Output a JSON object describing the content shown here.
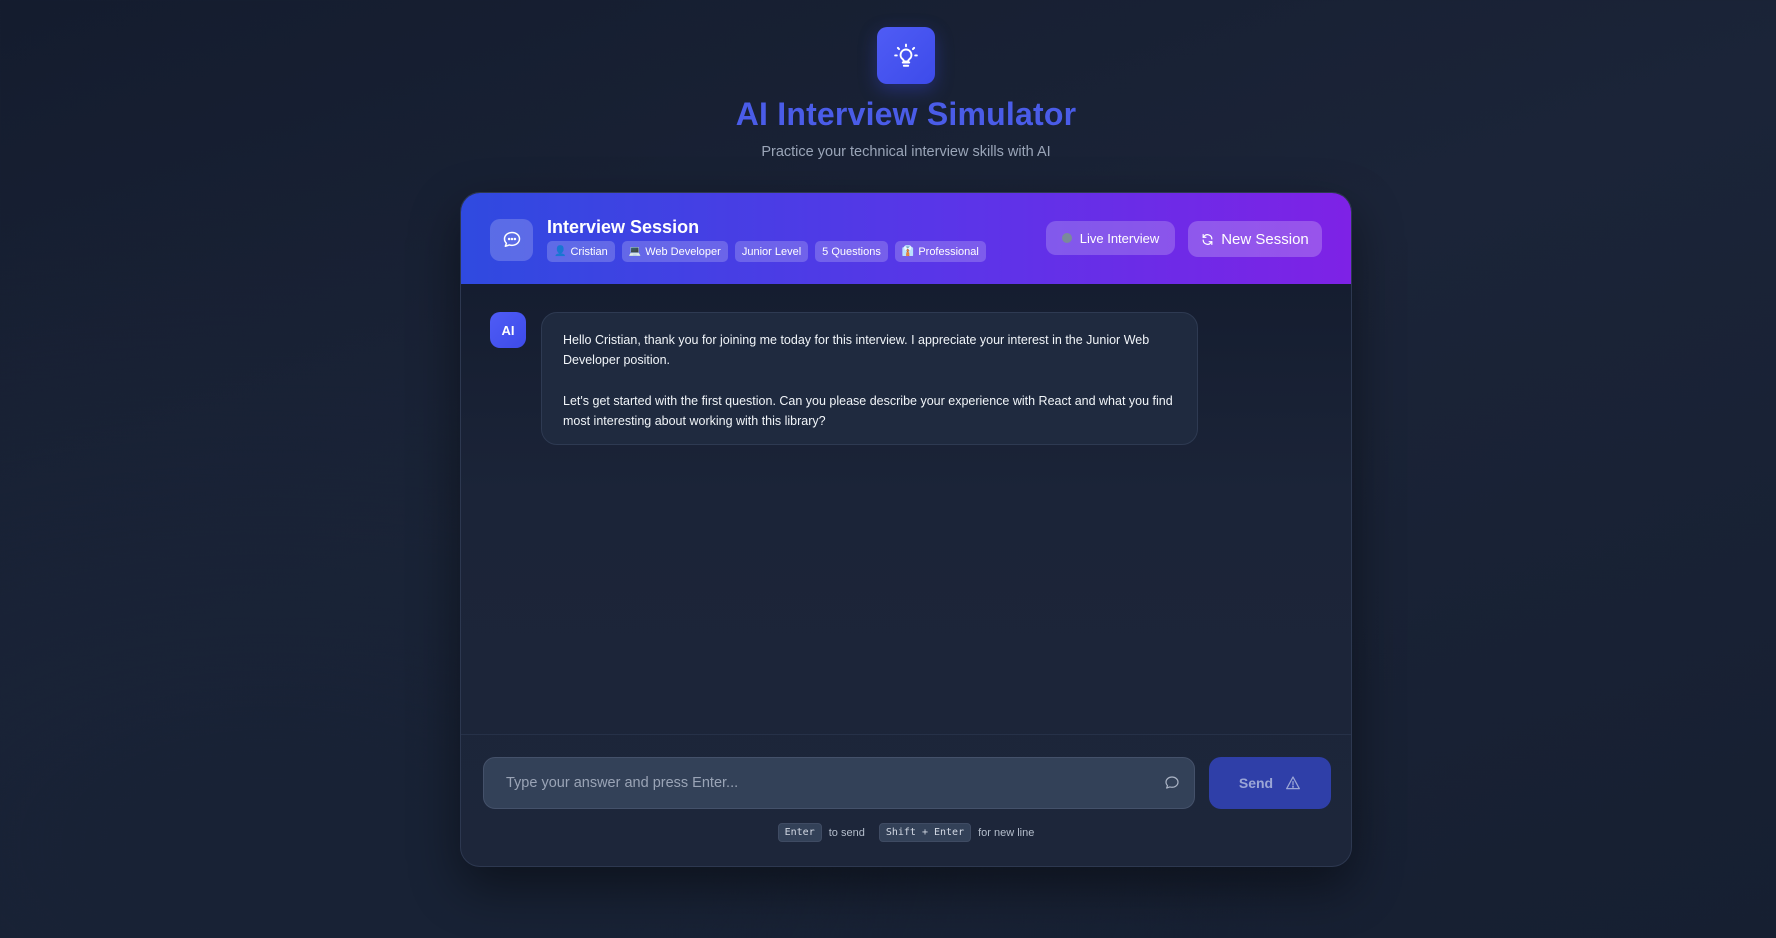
{
  "app": {
    "title": "AI Interview Simulator",
    "subtitle": "Practice your technical interview skills with AI",
    "logo_icon": "lightbulb-icon"
  },
  "session": {
    "title": "Interview Session",
    "tags": [
      {
        "icon": "user-icon",
        "label": "Cristian"
      },
      {
        "icon": "laptop-icon",
        "label": "Web Developer"
      },
      {
        "icon": "",
        "label": "Junior Level"
      },
      {
        "icon": "",
        "label": "5 Questions"
      },
      {
        "icon": "tie-icon",
        "label": "Professional"
      }
    ],
    "live_label": "Live Interview",
    "new_session_label": "New Session"
  },
  "messages": [
    {
      "sender": "AI",
      "paragraphs": [
        "Hello Cristian, thank you for joining me today for this interview. I appreciate your interest in the Junior Web Developer position.",
        "Let's get started with the first question. Can you please describe your experience with React and what you find most interesting about working with this library?"
      ]
    }
  ],
  "composer": {
    "placeholder": "Type your answer and press Enter...",
    "value": "",
    "send_label": "Send"
  },
  "hints": {
    "enter_key": "Enter",
    "enter_text": "to send",
    "shift_key": "Shift + Enter",
    "shift_text": "for new line"
  },
  "colors": {
    "accent": "#4a5ce8",
    "header_start": "#2f4ae0",
    "header_end": "#7e22e6",
    "background": "#1b2438"
  }
}
